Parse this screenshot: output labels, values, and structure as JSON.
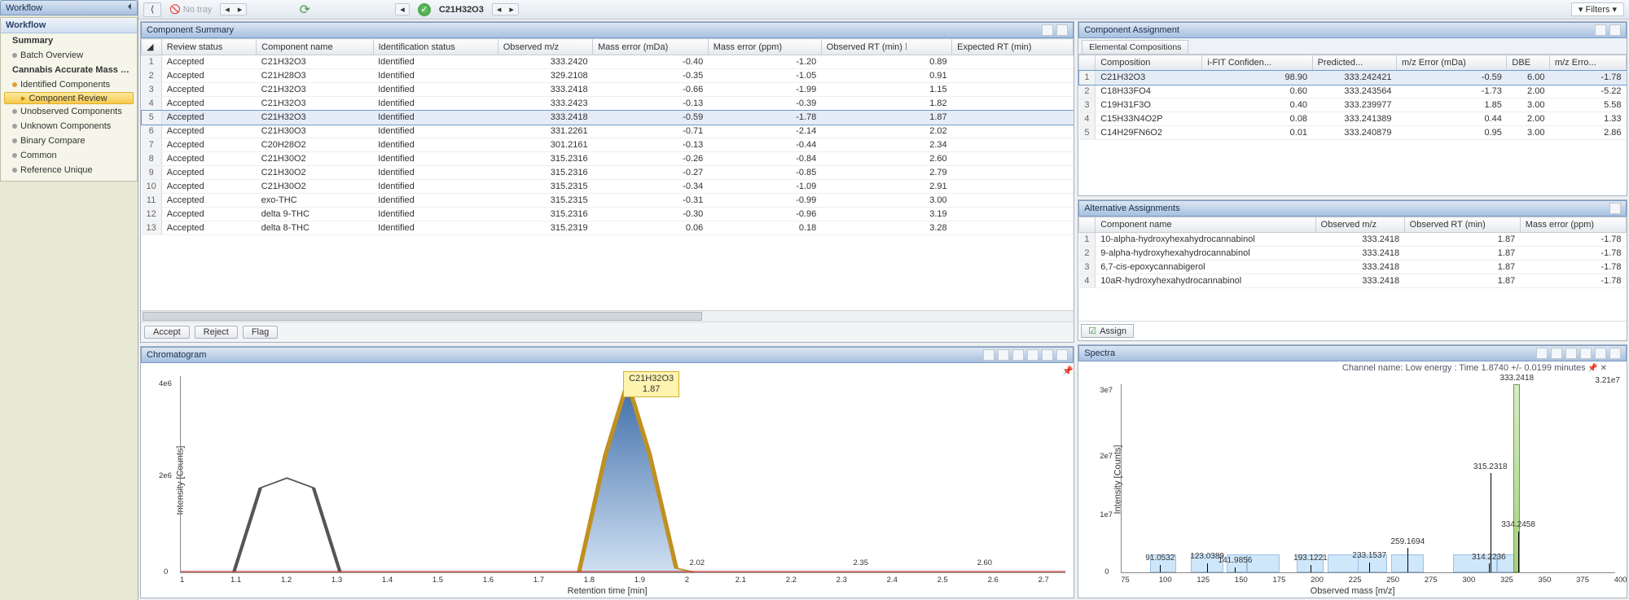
{
  "sidebar": {
    "workflow_label": "Workflow",
    "nav_title": "Workflow",
    "summary": "Summary",
    "batch": "Batch Overview",
    "screening": "Cannabis Accurate Mass Screenin...",
    "identified": "Identified Components",
    "component_review": "Component Review",
    "unobserved": "Unobserved Components",
    "unknown": "Unknown Components",
    "binary": "Binary Compare",
    "common": "Common",
    "reference": "Reference Unique"
  },
  "topbar": {
    "notray": "No tray",
    "component": "C21H32O3",
    "filters": "Filters"
  },
  "component_summary": {
    "title": "Component Summary",
    "cols": [
      "Review status",
      "Component name",
      "Identification status",
      "Observed m/z",
      "Mass error (mDa)",
      "Mass error (ppm)",
      "Observed RT (min)",
      "Expected RT (min)"
    ],
    "rows": [
      {
        "n": 1,
        "status": "Accepted",
        "name": "C21H32O3",
        "id": "Identified",
        "mz": "333.2420",
        "mda": "-0.40",
        "ppm": "-1.20",
        "rt": "0.89",
        "ert": ""
      },
      {
        "n": 2,
        "status": "Accepted",
        "name": "C21H28O3",
        "id": "Identified",
        "mz": "329.2108",
        "mda": "-0.35",
        "ppm": "-1.05",
        "rt": "0.91",
        "ert": ""
      },
      {
        "n": 3,
        "status": "Accepted",
        "name": "C21H32O3",
        "id": "Identified",
        "mz": "333.2418",
        "mda": "-0.66",
        "ppm": "-1.99",
        "rt": "1.15",
        "ert": ""
      },
      {
        "n": 4,
        "status": "Accepted",
        "name": "C21H32O3",
        "id": "Identified",
        "mz": "333.2423",
        "mda": "-0.13",
        "ppm": "-0.39",
        "rt": "1.82",
        "ert": ""
      },
      {
        "n": 5,
        "status": "Accepted",
        "name": "C21H32O3",
        "id": "Identified",
        "mz": "333.2418",
        "mda": "-0.59",
        "ppm": "-1.78",
        "rt": "1.87",
        "ert": "",
        "sel": true
      },
      {
        "n": 6,
        "status": "Accepted",
        "name": "C21H30O3",
        "id": "Identified",
        "mz": "331.2261",
        "mda": "-0.71",
        "ppm": "-2.14",
        "rt": "2.02",
        "ert": ""
      },
      {
        "n": 7,
        "status": "Accepted",
        "name": "C20H28O2",
        "id": "Identified",
        "mz": "301.2161",
        "mda": "-0.13",
        "ppm": "-0.44",
        "rt": "2.34",
        "ert": ""
      },
      {
        "n": 8,
        "status": "Accepted",
        "name": "C21H30O2",
        "id": "Identified",
        "mz": "315.2316",
        "mda": "-0.26",
        "ppm": "-0.84",
        "rt": "2.60",
        "ert": ""
      },
      {
        "n": 9,
        "status": "Accepted",
        "name": "C21H30O2",
        "id": "Identified",
        "mz": "315.2316",
        "mda": "-0.27",
        "ppm": "-0.85",
        "rt": "2.79",
        "ert": ""
      },
      {
        "n": 10,
        "status": "Accepted",
        "name": "C21H30O2",
        "id": "Identified",
        "mz": "315.2315",
        "mda": "-0.34",
        "ppm": "-1.09",
        "rt": "2.91",
        "ert": ""
      },
      {
        "n": 11,
        "status": "Accepted",
        "name": "exo-THC",
        "id": "Identified",
        "mz": "315.2315",
        "mda": "-0.31",
        "ppm": "-0.99",
        "rt": "3.00",
        "ert": ""
      },
      {
        "n": 12,
        "status": "Accepted",
        "name": "delta 9-THC",
        "id": "Identified",
        "mz": "315.2316",
        "mda": "-0.30",
        "ppm": "-0.96",
        "rt": "3.19",
        "ert": ""
      },
      {
        "n": 13,
        "status": "Accepted",
        "name": "delta 8-THC",
        "id": "Identified",
        "mz": "315.2319",
        "mda": "0.06",
        "ppm": "0.18",
        "rt": "3.28",
        "ert": ""
      }
    ],
    "buttons": {
      "accept": "Accept",
      "reject": "Reject",
      "flag": "Flag"
    }
  },
  "component_assignment": {
    "title": "Component Assignment",
    "tab": "Elemental Compositions",
    "cols": [
      "Composition",
      "i-FIT Confiden...",
      "Predicted...",
      "m/z Error (mDa)",
      "DBE",
      "m/z Erro..."
    ],
    "rows": [
      {
        "n": 1,
        "comp": "C21H32O3",
        "ifit": "98.90",
        "pred": "333.242421",
        "mda": "-0.59",
        "dbe": "6.00",
        "merr": "-1.78",
        "sel": true
      },
      {
        "n": 2,
        "comp": "C18H33FO4",
        "ifit": "0.60",
        "pred": "333.243564",
        "mda": "-1.73",
        "dbe": "2.00",
        "merr": "-5.22"
      },
      {
        "n": 3,
        "comp": "C19H31F3O",
        "ifit": "0.40",
        "pred": "333.239977",
        "mda": "1.85",
        "dbe": "3.00",
        "merr": "5.58"
      },
      {
        "n": 4,
        "comp": "C15H33N4O2P",
        "ifit": "0.08",
        "pred": "333.241389",
        "mda": "0.44",
        "dbe": "2.00",
        "merr": "1.33"
      },
      {
        "n": 5,
        "comp": "C14H29FN6O2",
        "ifit": "0.01",
        "pred": "333.240879",
        "mda": "0.95",
        "dbe": "3.00",
        "merr": "2.86"
      }
    ]
  },
  "alternative": {
    "title": "Alternative Assignments",
    "cols": [
      "Component name",
      "Observed m/z",
      "Observed RT (min)",
      "Mass error (ppm)"
    ],
    "rows": [
      {
        "n": 1,
        "name": "10-alpha-hydroxyhexahydrocannabinol",
        "mz": "333.2418",
        "rt": "1.87",
        "ppm": "-1.78"
      },
      {
        "n": 2,
        "name": "9-alpha-hydroxyhexahydrocannabinol",
        "mz": "333.2418",
        "rt": "1.87",
        "ppm": "-1.78"
      },
      {
        "n": 3,
        "name": "6,7-cis-epoxycannabigerol",
        "mz": "333.2418",
        "rt": "1.87",
        "ppm": "-1.78"
      },
      {
        "n": 4,
        "name": "10aR-hydroxyhexahydrocannabinol",
        "mz": "333.2418",
        "rt": "1.87",
        "ppm": "-1.78"
      }
    ],
    "assign": "Assign"
  },
  "chromatogram": {
    "title": "Chromatogram",
    "ylabel": "Intensity [Counts]",
    "xlabel": "Retention time [min]",
    "yTicks": [
      "0",
      "2e6",
      "4e6"
    ],
    "xTicks": [
      "1",
      "1.1",
      "1.2",
      "1.3",
      "1.4",
      "1.5",
      "1.6",
      "1.7",
      "1.8",
      "1.9",
      "2",
      "2.1",
      "2.2",
      "2.3",
      "2.4",
      "2.5",
      "2.6",
      "2.7"
    ],
    "callout_name": "C21H32O3",
    "callout_rt": "1.87",
    "marks": [
      "2.02",
      "2.35",
      "2.60"
    ]
  },
  "spectra": {
    "title": "Spectra",
    "subtitle": "Channel name: Low energy : Time 1.8740 +/- 0.0199 minutes",
    "max": "3.21e7",
    "ylabel": "Intensity [Counts]",
    "xlabel": "Observed mass [m/z]",
    "yTicks": [
      "0",
      "1e7",
      "2e7",
      "3e7"
    ],
    "xTicks": [
      "75",
      "100",
      "125",
      "150",
      "175",
      "200",
      "225",
      "250",
      "275",
      "300",
      "325",
      "350",
      "375",
      "400"
    ],
    "labels": [
      "91.0532",
      "123.0389",
      "141.9856",
      "193.1221",
      "233.1537",
      "259.1694",
      "314.2236",
      "315.2318",
      "333.2418",
      "334.2458"
    ]
  },
  "chart_data": [
    {
      "type": "line",
      "title": "Chromatogram",
      "xlabel": "Retention time [min]",
      "ylabel": "Intensity [Counts]",
      "xlim": [
        0.95,
        2.75
      ],
      "ylim": [
        0,
        5000000
      ],
      "peaks": [
        {
          "rt": 1.17,
          "intensity": 2500000,
          "name": "unlabeled"
        },
        {
          "rt": 1.87,
          "intensity": 4900000,
          "name": "C21H32O3"
        },
        {
          "rt": 2.02,
          "intensity": 150000
        },
        {
          "rt": 2.35,
          "intensity": 80000
        },
        {
          "rt": 2.6,
          "intensity": 80000
        }
      ]
    },
    {
      "type": "bar",
      "title": "Spectra",
      "subtitle": "Channel name: Low energy : Time 1.8740 +/- 0.0199 minutes",
      "xlabel": "Observed mass [m/z]",
      "ylabel": "Intensity [Counts]",
      "xlim": [
        65,
        400
      ],
      "ylim": [
        0,
        32100000
      ],
      "base_peak_mz": 333.2418,
      "series": [
        {
          "mz": 91.0532,
          "intensity": 1300000
        },
        {
          "mz": 123.0389,
          "intensity": 1600000
        },
        {
          "mz": 141.9856,
          "intensity": 900000
        },
        {
          "mz": 193.1221,
          "intensity": 1300000
        },
        {
          "mz": 233.1537,
          "intensity": 1700000
        },
        {
          "mz": 259.1694,
          "intensity": 4200000
        },
        {
          "mz": 314.2236,
          "intensity": 1500000
        },
        {
          "mz": 315.2318,
          "intensity": 17000000
        },
        {
          "mz": 333.2418,
          "intensity": 32100000
        },
        {
          "mz": 334.2458,
          "intensity": 7000000
        }
      ]
    }
  ]
}
